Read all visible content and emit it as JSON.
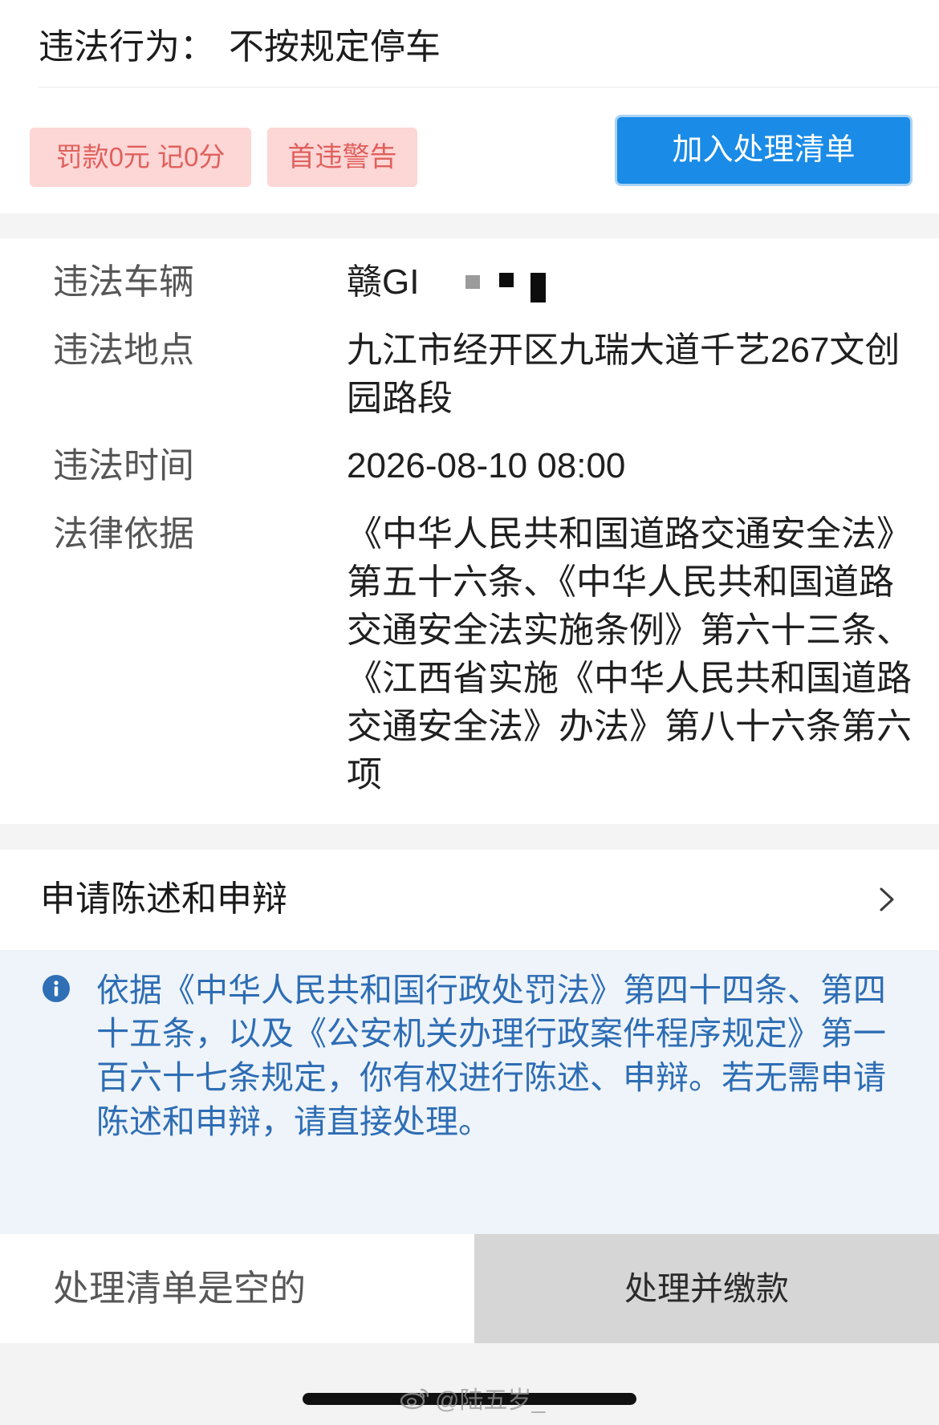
{
  "violation": {
    "label": "违法行为：",
    "value": "不按规定停车"
  },
  "tags": [
    "罚款0元 记0分",
    "首违警告"
  ],
  "add_button": "加入处理清单",
  "details": {
    "vehicle": {
      "label": "违法车辆",
      "value": "赣GI"
    },
    "location": {
      "label": "违法地点",
      "lines": [
        "九江市经开区九瑞大道千艺267文创",
        "园路段"
      ]
    },
    "time": {
      "label": "违法时间",
      "value": "2026-08-10 08:00"
    },
    "legal": {
      "label": "法律依据",
      "lines": [
        "《中华人民共和国道路交通安全法》",
        "第五十六条、《中华人民共和国道路",
        "交通安全法实施条例》第六十三条、",
        "《江西省实施《中华人民共和国道路",
        "交通安全法》办法》第八十六条第六",
        "项"
      ]
    }
  },
  "appeal": {
    "label": "申请陈述和申辩"
  },
  "notice": {
    "lines": [
      "依据《中华人民共和国行政处罚法》第四十四条、第四",
      "十五条，以及《公安机关办理行政案件程序规定》第一",
      "百六十七条规定，你有权进行陈述、申辩。若无需申请",
      "陈述和申辩，请直接处理。"
    ]
  },
  "bottom": {
    "list_status": "处理清单是空的",
    "pay_button": "处理并缴款"
  },
  "watermark": "@陆五岁_",
  "icons": {
    "info": "info-icon",
    "chevron": "chevron-right-icon",
    "watermark_logo": "weibo-logo-icon"
  },
  "colors": {
    "accent": "#1a8be6",
    "tag_bg": "#fdd6d6",
    "tag_text": "#e0605c",
    "notice_bg": "#eef4fa",
    "notice_text": "#2e6db4"
  }
}
